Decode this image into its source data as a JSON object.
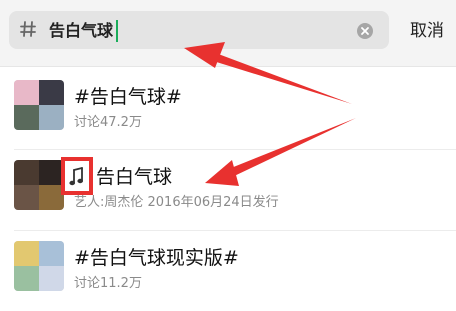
{
  "search": {
    "query": "告白气球",
    "cancel_label": "取消"
  },
  "results": [
    {
      "type": "topic",
      "title": "#告白气球#",
      "subtitle": "讨论47.2万"
    },
    {
      "type": "music",
      "title": "告白气球",
      "subtitle": "艺人:周杰伦  2016年06月24日发行"
    },
    {
      "type": "topic",
      "title": "#告白气球现实版#",
      "subtitle": "讨论11.2万"
    }
  ],
  "annotations": {
    "arrow_color": "#e8312f",
    "highlight_color": "#e8312f"
  },
  "colors": {
    "caret": "#1aad5a",
    "search_bg": "#e4e4e4",
    "topbar_bg": "#f4f4f4"
  }
}
